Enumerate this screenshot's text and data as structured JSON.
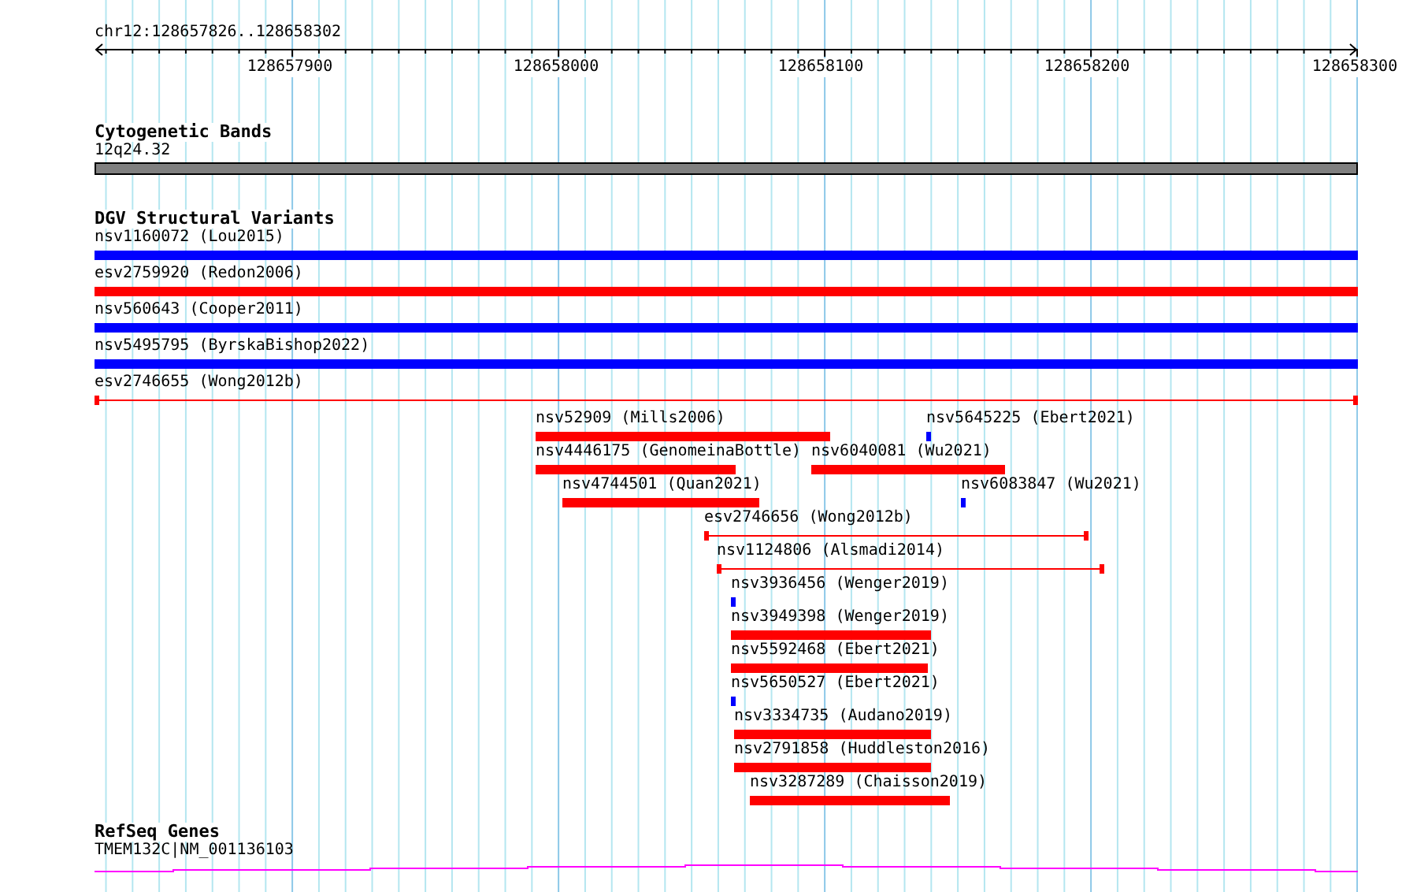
{
  "ruler": {
    "title": "chr12:128657826..128658302",
    "ticks": [
      "128657900",
      "128658000",
      "128658100",
      "128658200",
      "128658300"
    ]
  },
  "cytogenetic_bands": {
    "title": "Cytogenetic Bands",
    "band": {
      "label": "12q24.32"
    }
  },
  "structural_variants": {
    "title": "DGV Structural Variants",
    "features": [
      {
        "label": "nsv1160072 (Lou2015)",
        "color": "#0000ff",
        "kind": "solid"
      },
      {
        "label": "esv2759920 (Redon2006)",
        "color": "#ff0000",
        "kind": "solid"
      },
      {
        "label": "nsv560643 (Cooper2011)",
        "color": "#0000ff",
        "kind": "solid"
      },
      {
        "label": "nsv5495795 (ByrskaBishop2022)",
        "color": "#0000ff",
        "kind": "solid"
      },
      {
        "label": "esv2746655 (Wong2012b)",
        "color": "#ff0000",
        "kind": "span"
      },
      {
        "label": "nsv52909 (Mills2006)",
        "color": "#ff0000",
        "kind": "solid"
      },
      {
        "label": "nsv5645225 (Ebert2021)",
        "color": "#0000ff",
        "kind": "solid"
      },
      {
        "label": "nsv4446175 (GenomeinaBottle)",
        "color": "#ff0000",
        "kind": "solid"
      },
      {
        "label": "nsv6040081 (Wu2021)",
        "color": "#ff0000",
        "kind": "solid"
      },
      {
        "label": "nsv4744501 (Quan2021)",
        "color": "#ff0000",
        "kind": "solid"
      },
      {
        "label": "nsv6083847 (Wu2021)",
        "color": "#0000ff",
        "kind": "solid"
      },
      {
        "label": "esv2746656 (Wong2012b)",
        "color": "#ff0000",
        "kind": "span"
      },
      {
        "label": "nsv1124806 (Alsmadi2014)",
        "color": "#ff0000",
        "kind": "span"
      },
      {
        "label": "nsv3936456 (Wenger2019)",
        "color": "#0000ff",
        "kind": "solid"
      },
      {
        "label": "nsv3949398 (Wenger2019)",
        "color": "#ff0000",
        "kind": "solid"
      },
      {
        "label": "nsv5592468 (Ebert2021)",
        "color": "#ff0000",
        "kind": "solid"
      },
      {
        "label": "nsv5650527 (Ebert2021)",
        "color": "#0000ff",
        "kind": "solid"
      },
      {
        "label": "nsv3334735 (Audano2019)",
        "color": "#ff0000",
        "kind": "solid"
      },
      {
        "label": "nsv2791858 (Huddleston2016)",
        "color": "#ff0000",
        "kind": "solid"
      },
      {
        "label": "nsv3287289 (Chaisson2019)",
        "color": "#ff0000",
        "kind": "solid"
      }
    ]
  },
  "refseq_genes": {
    "title": "RefSeq Genes",
    "gene": {
      "label": "TMEM132C|NM_001136103"
    }
  }
}
